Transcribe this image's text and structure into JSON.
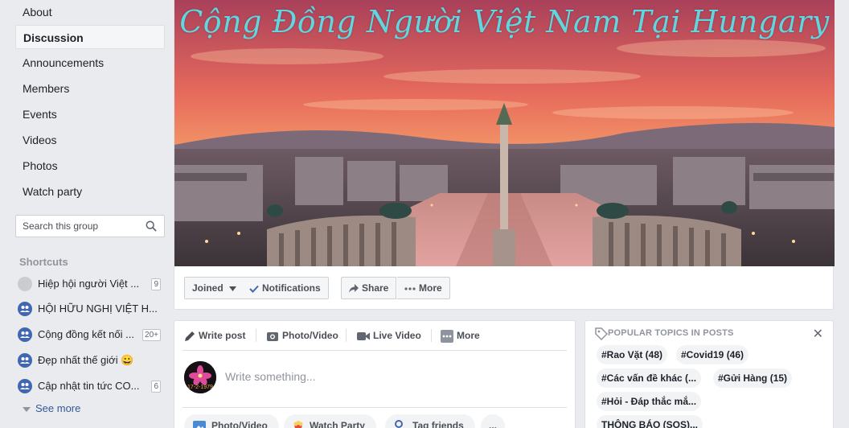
{
  "sidebar": {
    "nav": [
      "About",
      "Discussion",
      "Announcements",
      "Members",
      "Events",
      "Videos",
      "Photos",
      "Watch party"
    ],
    "search_placeholder": "Search this group",
    "shortcuts_title": "Shortcuts",
    "shortcuts": [
      {
        "label": "Hiệp hội người Việt ...",
        "badge": "9"
      },
      {
        "label": "HỘI HỮU NGHỊ VIỆT H...",
        "badge": ""
      },
      {
        "label": "Cộng đồng kết nối ...",
        "badge": "20+"
      },
      {
        "label": "Đẹp nhất thế giới 😀",
        "badge": ""
      },
      {
        "label": "Cập nhật tin tức CO...",
        "badge": "6"
      }
    ],
    "see_more": "See more"
  },
  "cover": {
    "title": "Cộng Đồng Người Việt Nam Tại Hungary"
  },
  "actions": {
    "joined": "Joined",
    "notifications": "Notifications",
    "share": "Share",
    "more": "More"
  },
  "composer": {
    "tabs": [
      "Write post",
      "Photo/Video",
      "Live Video",
      "More"
    ],
    "placeholder": "Write something...",
    "avatar_text": "17-2-1979",
    "bottom": [
      "Photo/Video",
      "Watch Party",
      "Tag friends",
      "..."
    ]
  },
  "topics": {
    "title": "POPULAR TOPICS IN POSTS",
    "chips": [
      "#Rao Vặt (48)",
      "#Covid19 (46)",
      "#Các vấn đề khác (...",
      "#Gửi Hàng (15)",
      "#Hỏi - Đáp thắc mắ...",
      "THÔNG BÁO (SOS)..."
    ]
  },
  "colors": {
    "accent": "#4267b2",
    "link": "#365899",
    "cover_title": "#5fd6e0"
  }
}
